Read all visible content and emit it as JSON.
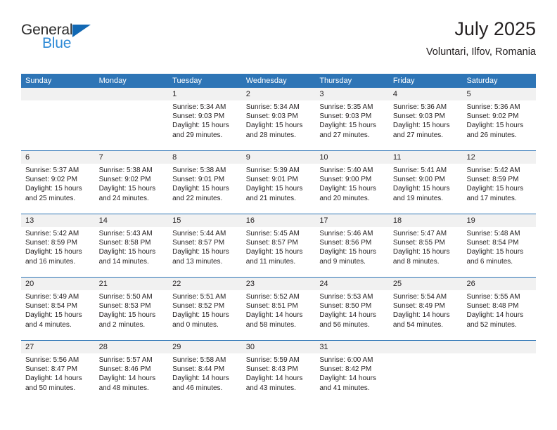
{
  "brand": {
    "word_general": "General",
    "word_blue": "Blue",
    "triangle_color": "#1268b3",
    "blue_text_color": "#2e8ad6"
  },
  "header": {
    "title": "July 2025",
    "subtitle": "Voluntari, Ilfov, Romania"
  },
  "theme": {
    "header_blue": "#2e75b6",
    "number_band_gray": "#f1f1f1",
    "text_color": "#231f20"
  },
  "weekdays": [
    "Sunday",
    "Monday",
    "Tuesday",
    "Wednesday",
    "Thursday",
    "Friday",
    "Saturday"
  ],
  "weeks": [
    [
      {
        "day": "",
        "lines": []
      },
      {
        "day": "",
        "lines": []
      },
      {
        "day": "1",
        "lines": [
          "Sunrise: 5:34 AM",
          "Sunset: 9:03 PM",
          "Daylight: 15 hours",
          "and 29 minutes."
        ]
      },
      {
        "day": "2",
        "lines": [
          "Sunrise: 5:34 AM",
          "Sunset: 9:03 PM",
          "Daylight: 15 hours",
          "and 28 minutes."
        ]
      },
      {
        "day": "3",
        "lines": [
          "Sunrise: 5:35 AM",
          "Sunset: 9:03 PM",
          "Daylight: 15 hours",
          "and 27 minutes."
        ]
      },
      {
        "day": "4",
        "lines": [
          "Sunrise: 5:36 AM",
          "Sunset: 9:03 PM",
          "Daylight: 15 hours",
          "and 27 minutes."
        ]
      },
      {
        "day": "5",
        "lines": [
          "Sunrise: 5:36 AM",
          "Sunset: 9:02 PM",
          "Daylight: 15 hours",
          "and 26 minutes."
        ]
      }
    ],
    [
      {
        "day": "6",
        "lines": [
          "Sunrise: 5:37 AM",
          "Sunset: 9:02 PM",
          "Daylight: 15 hours",
          "and 25 minutes."
        ]
      },
      {
        "day": "7",
        "lines": [
          "Sunrise: 5:38 AM",
          "Sunset: 9:02 PM",
          "Daylight: 15 hours",
          "and 24 minutes."
        ]
      },
      {
        "day": "8",
        "lines": [
          "Sunrise: 5:38 AM",
          "Sunset: 9:01 PM",
          "Daylight: 15 hours",
          "and 22 minutes."
        ]
      },
      {
        "day": "9",
        "lines": [
          "Sunrise: 5:39 AM",
          "Sunset: 9:01 PM",
          "Daylight: 15 hours",
          "and 21 minutes."
        ]
      },
      {
        "day": "10",
        "lines": [
          "Sunrise: 5:40 AM",
          "Sunset: 9:00 PM",
          "Daylight: 15 hours",
          "and 20 minutes."
        ]
      },
      {
        "day": "11",
        "lines": [
          "Sunrise: 5:41 AM",
          "Sunset: 9:00 PM",
          "Daylight: 15 hours",
          "and 19 minutes."
        ]
      },
      {
        "day": "12",
        "lines": [
          "Sunrise: 5:42 AM",
          "Sunset: 8:59 PM",
          "Daylight: 15 hours",
          "and 17 minutes."
        ]
      }
    ],
    [
      {
        "day": "13",
        "lines": [
          "Sunrise: 5:42 AM",
          "Sunset: 8:59 PM",
          "Daylight: 15 hours",
          "and 16 minutes."
        ]
      },
      {
        "day": "14",
        "lines": [
          "Sunrise: 5:43 AM",
          "Sunset: 8:58 PM",
          "Daylight: 15 hours",
          "and 14 minutes."
        ]
      },
      {
        "day": "15",
        "lines": [
          "Sunrise: 5:44 AM",
          "Sunset: 8:57 PM",
          "Daylight: 15 hours",
          "and 13 minutes."
        ]
      },
      {
        "day": "16",
        "lines": [
          "Sunrise: 5:45 AM",
          "Sunset: 8:57 PM",
          "Daylight: 15 hours",
          "and 11 minutes."
        ]
      },
      {
        "day": "17",
        "lines": [
          "Sunrise: 5:46 AM",
          "Sunset: 8:56 PM",
          "Daylight: 15 hours",
          "and 9 minutes."
        ]
      },
      {
        "day": "18",
        "lines": [
          "Sunrise: 5:47 AM",
          "Sunset: 8:55 PM",
          "Daylight: 15 hours",
          "and 8 minutes."
        ]
      },
      {
        "day": "19",
        "lines": [
          "Sunrise: 5:48 AM",
          "Sunset: 8:54 PM",
          "Daylight: 15 hours",
          "and 6 minutes."
        ]
      }
    ],
    [
      {
        "day": "20",
        "lines": [
          "Sunrise: 5:49 AM",
          "Sunset: 8:54 PM",
          "Daylight: 15 hours",
          "and 4 minutes."
        ]
      },
      {
        "day": "21",
        "lines": [
          "Sunrise: 5:50 AM",
          "Sunset: 8:53 PM",
          "Daylight: 15 hours",
          "and 2 minutes."
        ]
      },
      {
        "day": "22",
        "lines": [
          "Sunrise: 5:51 AM",
          "Sunset: 8:52 PM",
          "Daylight: 15 hours",
          "and 0 minutes."
        ]
      },
      {
        "day": "23",
        "lines": [
          "Sunrise: 5:52 AM",
          "Sunset: 8:51 PM",
          "Daylight: 14 hours",
          "and 58 minutes."
        ]
      },
      {
        "day": "24",
        "lines": [
          "Sunrise: 5:53 AM",
          "Sunset: 8:50 PM",
          "Daylight: 14 hours",
          "and 56 minutes."
        ]
      },
      {
        "day": "25",
        "lines": [
          "Sunrise: 5:54 AM",
          "Sunset: 8:49 PM",
          "Daylight: 14 hours",
          "and 54 minutes."
        ]
      },
      {
        "day": "26",
        "lines": [
          "Sunrise: 5:55 AM",
          "Sunset: 8:48 PM",
          "Daylight: 14 hours",
          "and 52 minutes."
        ]
      }
    ],
    [
      {
        "day": "27",
        "lines": [
          "Sunrise: 5:56 AM",
          "Sunset: 8:47 PM",
          "Daylight: 14 hours",
          "and 50 minutes."
        ]
      },
      {
        "day": "28",
        "lines": [
          "Sunrise: 5:57 AM",
          "Sunset: 8:46 PM",
          "Daylight: 14 hours",
          "and 48 minutes."
        ]
      },
      {
        "day": "29",
        "lines": [
          "Sunrise: 5:58 AM",
          "Sunset: 8:44 PM",
          "Daylight: 14 hours",
          "and 46 minutes."
        ]
      },
      {
        "day": "30",
        "lines": [
          "Sunrise: 5:59 AM",
          "Sunset: 8:43 PM",
          "Daylight: 14 hours",
          "and 43 minutes."
        ]
      },
      {
        "day": "31",
        "lines": [
          "Sunrise: 6:00 AM",
          "Sunset: 8:42 PM",
          "Daylight: 14 hours",
          "and 41 minutes."
        ]
      },
      {
        "day": "",
        "lines": []
      },
      {
        "day": "",
        "lines": []
      }
    ]
  ]
}
